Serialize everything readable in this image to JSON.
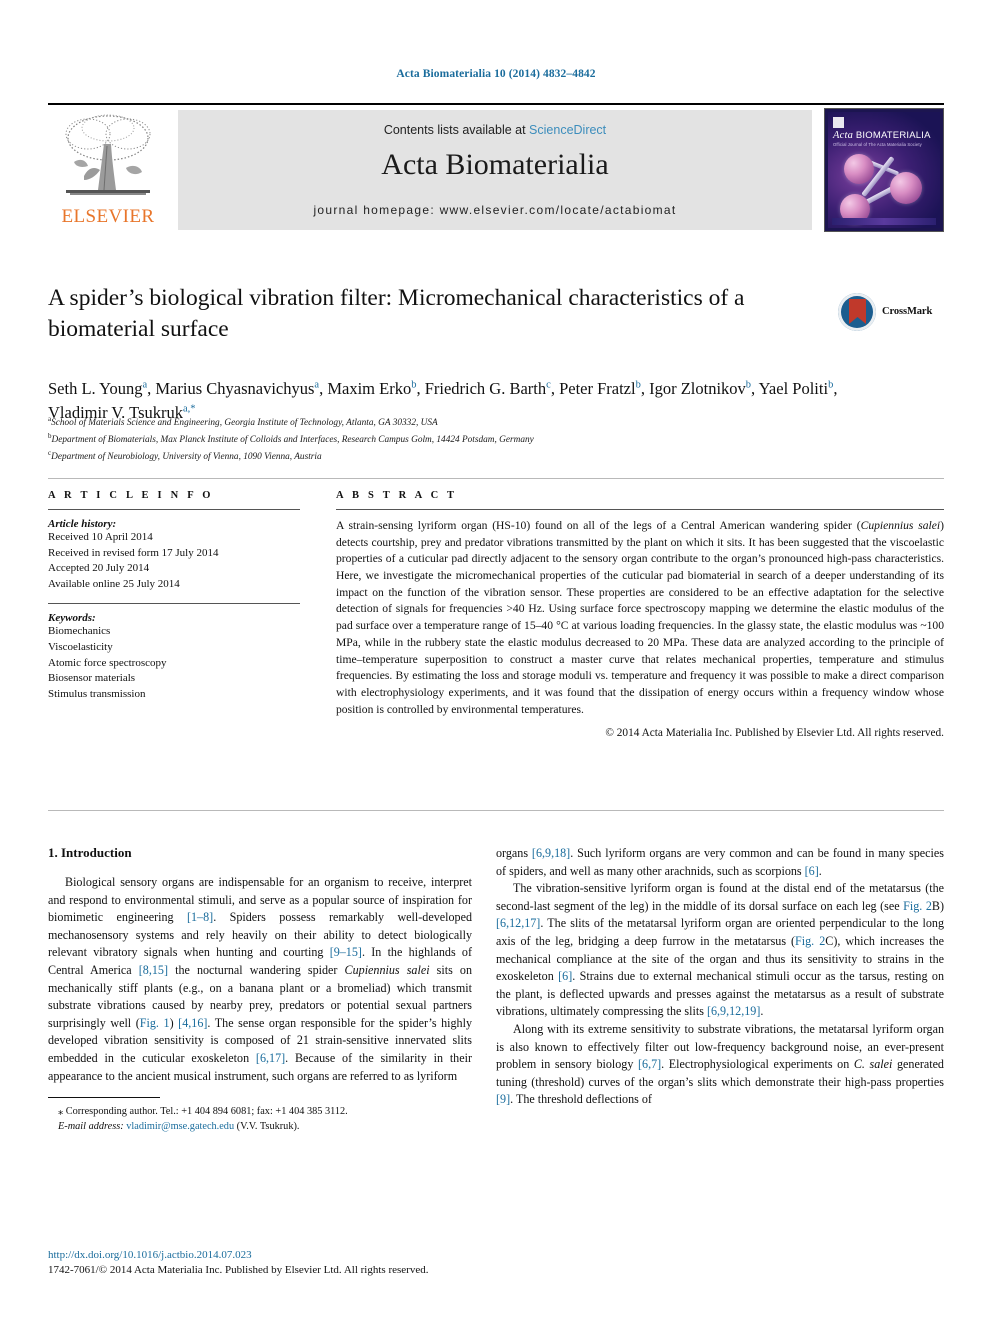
{
  "running_head": "Acta Biomaterialia 10 (2014) 4832–4842",
  "header": {
    "contents_prefix": "Contents lists available at ",
    "sciencedirect": "ScienceDirect",
    "journal_title": "Acta Biomaterialia",
    "homepage": "journal homepage: www.elsevier.com/locate/actabiomat",
    "publisher_logo_text": "ELSEVIER",
    "cover_title_italic": "Acta",
    "cover_title_rest": " BIOMATERIALIA",
    "cover_subtitle": "Official Journal of The Acta Materialia Society",
    "accent_link_color": "#3c8dbc",
    "elsevier_orange": "#e8752a"
  },
  "article": {
    "title": "A spider’s biological vibration filter: Micromechanical characteristics of a biomaterial surface",
    "crossmark_label": "CrossMark",
    "authors_html": "Seth L. Young<sup>a</sup>, Marius Chyasnavichyus<sup>a</sup>, Maxim Erko<sup>b</sup>, Friedrich G. Barth<sup>c</sup>, Peter Fratzl<sup>b</sup>, Igor Zlotnikov<sup>b</sup>, Yael Politi<sup>b</sup>, Vladimir V. Tsukruk<sup>a,*</sup>",
    "affiliations": [
      {
        "marker": "a",
        "text": "School of Materials Science and Engineering, Georgia Institute of Technology, Atlanta, GA 30332, USA"
      },
      {
        "marker": "b",
        "text": "Department of Biomaterials, Max Planck Institute of Colloids and Interfaces, Research Campus Golm, 14424 Potsdam, Germany"
      },
      {
        "marker": "c",
        "text": "Department of Neurobiology, University of Vienna, 1090 Vienna, Austria"
      }
    ]
  },
  "article_info": {
    "heading": "A R T I C L E   I N F O",
    "history_label": "Article history:",
    "history": [
      "Received 10 April 2014",
      "Received in revised form 17 July 2014",
      "Accepted 20 July 2014",
      "Available online 25 July 2014"
    ],
    "keywords_label": "Keywords:",
    "keywords": [
      "Biomechanics",
      "Viscoelasticity",
      "Atomic force spectroscopy",
      "Biosensor materials",
      "Stimulus transmission"
    ]
  },
  "abstract": {
    "heading": "A B S T R A C T",
    "text_html": "A strain-sensing lyriform organ (HS-10) found on all of the legs of a Central American wandering spider (<i>Cupiennius salei</i>) detects courtship, prey and predator vibrations transmitted by the plant on which it sits. It has been suggested that the viscoelastic properties of a cuticular pad directly adjacent to the sensory organ contribute to the organ’s pronounced high-pass characteristics. Here, we investigate the micromechanical properties of the cuticular pad biomaterial in search of a deeper understanding of its impact on the function of the vibration sensor. These properties are considered to be an effective adaptation for the selective detection of signals for frequencies &gt;40 Hz. Using surface force spectroscopy mapping we determine the elastic modulus of the pad surface over a temperature range of 15–40 °C at various loading frequencies. In the glassy state, the elastic modulus was ~100 MPa, while in the rubbery state the elastic modulus decreased to 20 MPa. These data are analyzed according to the principle of time–temperature superposition to construct a master curve that relates mechanical properties, temperature and stimulus frequencies. By estimating the loss and storage moduli vs. temperature and frequency it was possible to make a direct comparison with electrophysiology experiments, and it was found that the dissipation of energy occurs within a frequency window whose position is controlled by environmental temperatures.",
    "copyright": "© 2014 Acta Materialia Inc. Published by Elsevier Ltd. All rights reserved."
  },
  "body": {
    "section_heading": "1. Introduction",
    "left_paragraphs_html": [
      "Biological sensory organs are indispensable for an organism to receive, interpret and respond to environmental stimuli, and serve as a popular source of inspiration for biomimetic engineering <span class=\"ref\">[1–8]</span>. Spiders possess remarkably well-developed mechanosensory systems and rely heavily on their ability to detect biologically relevant vibratory signals when hunting and courting <span class=\"ref\">[9–15]</span>. In the highlands of Central America <span class=\"ref\">[8,15]</span> the nocturnal wandering spider <i>Cupiennius salei</i> sits on mechanically stiff plants (e.g., on a banana plant or a bromeliad) which transmit substrate vibrations caused by nearby prey, predators or potential sexual partners surprisingly well (<span class=\"ref\">Fig. 1</span>) <span class=\"ref\">[4,16]</span>. The sense organ responsible for the spider’s highly developed vibration sensitivity is composed of 21 strain-sensitive innervated slits embedded in the cuticular exoskeleton <span class=\"ref\">[6,17]</span>. Because of the similarity in their appearance to the ancient musical instrument, such organs are referred to as lyriform"
    ],
    "right_paragraphs_html": [
      "organs <span class=\"ref\">[6,9,18]</span>. Such lyriform organs are very common and can be found in many species of spiders, and well as many other arachnids, such as scorpions <span class=\"ref\">[6]</span>.",
      "The vibration-sensitive lyriform organ is found at the distal end of the metatarsus (the second-last segment of the leg) in the middle of its dorsal surface on each leg (see <span class=\"ref\">Fig. 2</span>B) <span class=\"ref\">[6,12,17]</span>. The slits of the metatarsal lyriform organ are oriented perpendicular to the long axis of the leg, bridging a deep furrow in the metatarsus (<span class=\"ref\">Fig. 2</span>C), which increases the mechanical compliance at the site of the organ and thus its sensitivity to strains in the exoskeleton <span class=\"ref\">[6]</span>. Strains due to external mechanical stimuli occur as the tarsus, resting on the plant, is deflected upwards and presses against the metatarsus as a result of substrate vibrations, ultimately compressing the slits <span class=\"ref\">[6,9,12,19]</span>.",
      "Along with its extreme sensitivity to substrate vibrations, the metatarsal lyriform organ is also known to effectively filter out low-frequency background noise, an ever-present problem in sensory biology <span class=\"ref\">[6,7]</span>. Electrophysiological experiments on <i>C. salei</i> generated tuning (threshold) curves of the organ’s slits which demonstrate their high-pass properties <span class=\"ref\">[9]</span>. The threshold deflections of"
    ]
  },
  "footnote": {
    "corresponding_html": "<span class=\"ind\"></span>⁎ Corresponding author. Tel.: +1 404 894 6081; fax: +1 404 385 3112.",
    "email_label": "E-mail address:",
    "email": "vladimir@mse.gatech.edu",
    "email_suffix": " (V.V. Tsukruk)."
  },
  "imprint": {
    "doi": "http://dx.doi.org/10.1016/j.actbio.2014.07.023",
    "issn_line": "1742-7061/© 2014 Acta Materialia Inc. Published by Elsevier Ltd. All rights reserved."
  }
}
